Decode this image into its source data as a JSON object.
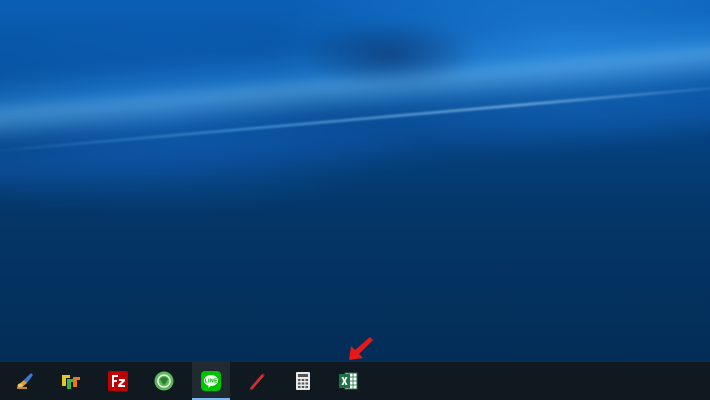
{
  "taskbar": {
    "apps": [
      {
        "id": "paint-tool",
        "icon": "paint-tool-icon",
        "active": false
      },
      {
        "id": "ffftp",
        "icon": "ffftp-icon",
        "active": false
      },
      {
        "id": "filezilla",
        "icon": "filezilla-icon",
        "active": false
      },
      {
        "id": "globe-app",
        "icon": "green-globe-icon",
        "active": false
      },
      {
        "id": "line",
        "icon": "line-messenger-icon",
        "active": true,
        "label": "LINE"
      },
      {
        "id": "pen-tool",
        "icon": "red-pen-icon",
        "active": false
      },
      {
        "id": "calculator",
        "icon": "calculator-icon",
        "active": false
      },
      {
        "id": "excel",
        "icon": "excel-icon",
        "active": false
      }
    ],
    "background_color": "#101820",
    "active_indicator_color": "#76b9ed"
  },
  "annotation": {
    "icon": "red-arrow-icon",
    "color": "#e81818",
    "points_to": "excel"
  }
}
